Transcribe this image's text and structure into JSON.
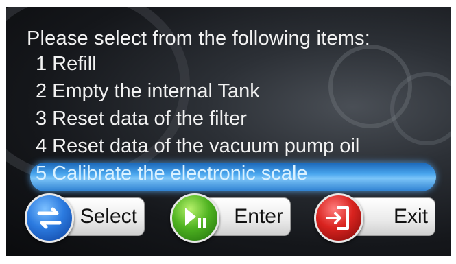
{
  "header": {
    "title": "Please select from the following items:"
  },
  "menu": {
    "items": [
      {
        "label": "1 Refill"
      },
      {
        "label": "2 Empty the internal Tank"
      },
      {
        "label": "3 Reset data of the filter"
      },
      {
        "label": "4 Reset data of the vacuum pump oil"
      },
      {
        "label": "5 Calibrate the electronic scale"
      }
    ],
    "selected_index": 4
  },
  "buttons": {
    "select": {
      "label": "Select",
      "icon": "swap-arrows-icon",
      "color": "#2c7be0"
    },
    "enter": {
      "label": "Enter",
      "icon": "play-pause-icon",
      "color": "#4fb321"
    },
    "exit": {
      "label": "Exit",
      "icon": "exit-door-icon",
      "color": "#d9231f"
    }
  }
}
